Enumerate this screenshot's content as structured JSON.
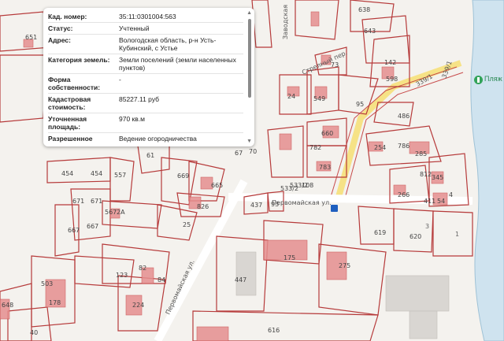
{
  "popup": {
    "rows": [
      {
        "k": "Кад. номер:",
        "v": "35:11:0301004:563"
      },
      {
        "k": "Статус:",
        "v": "Учтенный"
      },
      {
        "k": "Адрес:",
        "v": "Вологодская область, р-н Усть-Кубинский, с Устье"
      },
      {
        "k": "Категория земель:",
        "v": "Земли поселений (земли населенных пунктов)"
      },
      {
        "k": "Форма собственности:",
        "v": "-"
      },
      {
        "k": "Кадастровая стоимость:",
        "v": "85227.11 руб"
      },
      {
        "k": "Уточненная площадь:",
        "v": "970 кв.м"
      },
      {
        "k": "Разрешенное",
        "v": "Ведение огородничества"
      }
    ]
  },
  "map": {
    "streets": [
      "Заводская",
      "Первомайская ул.",
      "Первомайская ул.",
      "Стрелный пер.",
      "339/1",
      "339/1"
    ],
    "beach": "Пляж",
    "labels": [
      "651",
      "638",
      "643",
      "142",
      "598",
      "73",
      "24",
      "549",
      "95",
      "486",
      "660",
      "782",
      "783",
      "786",
      "285",
      "254",
      "812",
      "345",
      "4",
      "411",
      "266",
      "54",
      "70",
      "67",
      "669",
      "665",
      "826",
      "567",
      "557",
      "454",
      "454",
      "671",
      "671",
      "667",
      "667",
      "25",
      "437",
      "93",
      "108",
      "533/2",
      "533/2",
      "619",
      "620",
      "3",
      "1",
      "123",
      "82",
      "84",
      "503",
      "178",
      "224",
      "447",
      "175",
      "275",
      "616",
      "648",
      "40",
      "2A",
      "61"
    ]
  }
}
